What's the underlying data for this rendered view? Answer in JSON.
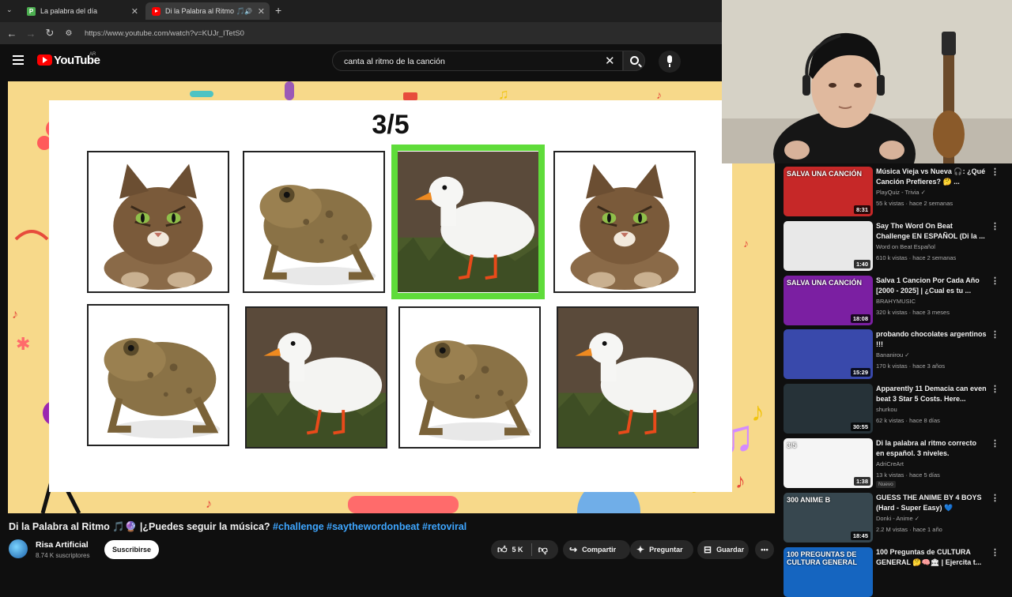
{
  "browser": {
    "tabs": [
      {
        "label": "La palabra del día",
        "icon": "P",
        "icon_color": "#4caf50"
      },
      {
        "label": "Di la Palabra al Ritmo 🎵",
        "icon": "youtube-icon",
        "icon_color": "#ff0000"
      }
    ],
    "url": "https://www.youtube.com/watch?v=KUJr_ITetS0"
  },
  "header": {
    "logo_text": "YouTube",
    "region": "AR",
    "search_query": "canta al ritmo de la canción"
  },
  "player": {
    "counter": "3/5",
    "active_card_index": 2,
    "highlight_color": "#5fdc3a",
    "cards": [
      {
        "animal": "cat"
      },
      {
        "animal": "toad"
      },
      {
        "animal": "duck"
      },
      {
        "animal": "cat"
      },
      {
        "animal": "toad"
      },
      {
        "animal": "duck"
      },
      {
        "animal": "toad"
      },
      {
        "animal": "duck"
      }
    ]
  },
  "video": {
    "title": "Di la Palabra al Ritmo 🎵🔮 |¿Puedes seguir la música?",
    "tags": "#challenge #saythewordonbeat #retoviral",
    "channel": "Risa Artificial",
    "subscribers": "8.74 K suscriptores",
    "subscribe_label": "Suscribirse",
    "likes": "5 K",
    "share_label": "Compartir",
    "ask_label": "Preguntar",
    "save_label": "Guardar"
  },
  "sidebar": {
    "items": [
      {
        "title": "Música Vieja vs Nueva 🎧: ¿Qué Canción Prefieres? 🤔 ...",
        "channel": "PlayQuiz - Trivia ✓",
        "meta": "55 k vistas · hace 2 semanas",
        "duration": "8:31",
        "thumb_text": "SALVA UNA CANCIÓN",
        "thumb_color": "#c62828"
      },
      {
        "title": "Say The Word On Beat Challenge EN ESPAÑOL (Di la ...",
        "channel": "Word on Beat Español",
        "meta": "610 k vistas · hace 2 semanas",
        "duration": "1:40",
        "thumb_text": "",
        "thumb_color": "#e8e8e8"
      },
      {
        "title": "Salva 1 Cancion Por Cada Año [2000 - 2025] | ¿Cual es tu ...",
        "channel": "BRAHYMUSIC",
        "meta": "320 k vistas · hace 3 meses",
        "duration": "18:08",
        "thumb_text": "SALVA UNA CANCIÓN",
        "thumb_color": "#7b1fa2"
      },
      {
        "title": "probando chocolates argentinos !!!",
        "channel": "Bananirou ✓",
        "meta": "170 k vistas · hace 3 años",
        "duration": "15:29",
        "thumb_text": "",
        "thumb_color": "#3949ab"
      },
      {
        "title": "Apparently 11 Demacia can even beat 3 Star 5 Costs. Here...",
        "channel": "shurkou",
        "meta": "62 k vistas · hace 8 días",
        "duration": "30:55",
        "thumb_text": "",
        "thumb_color": "#263238"
      },
      {
        "title": "Di la palabra al ritmo correcto en español. 3 niveles.",
        "channel": "AdriCreArt",
        "meta": "13 k vistas · hace 5 días",
        "duration": "1:38",
        "thumb_text": "3/5",
        "thumb_color": "#f5f5f5",
        "badge": "Nuevo"
      },
      {
        "title": "GUESS THE ANIME BY 4 BOYS (Hard - Super Easy) 💙",
        "channel": "Donki - Anime ✓",
        "meta": "2.2 M vistas · hace 1 año",
        "duration": "18:45",
        "thumb_text": "300 ANIME B",
        "thumb_color": "#37474f"
      },
      {
        "title": "100 Preguntas de CULTURA GENERAL 🤔🧠🏛 | Ejercita t...",
        "channel": "",
        "meta": "",
        "duration": "",
        "thumb_text": "100 PREGUNTAS DE CULTURA GENERAL",
        "thumb_color": "#1565c0"
      }
    ]
  }
}
